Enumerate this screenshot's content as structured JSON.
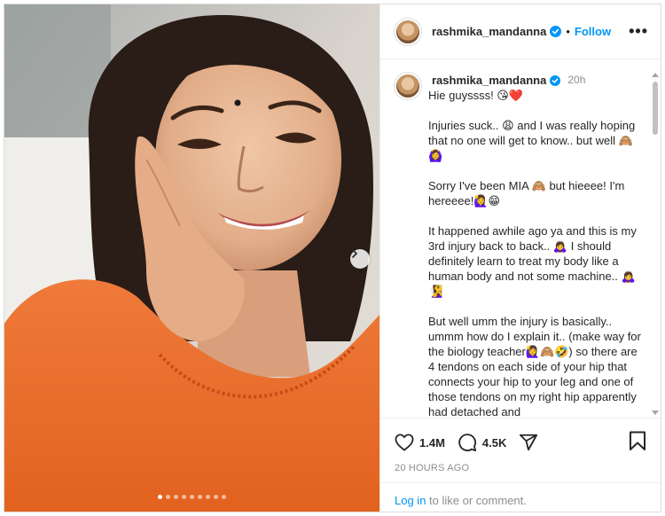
{
  "post": {
    "username": "rashmika_mandanna",
    "follow_label": "Follow",
    "separator": "•",
    "more_label": "•••",
    "time_ago": "20h",
    "caption_first_line": "Hie guyssss! 😘❤️",
    "caption_paragraphs": [
      "Injuries suck.. 😩 and I was really hoping that no one will get to know.. but well 🙈🙆‍♀️",
      "Sorry I've been MIA 🙈 but hieeee! I'm hereeee!🙋‍♀️😁",
      "It happened awhile ago ya and this is my 3rd injury back to back.. 🙇‍♀️ I should definitely learn to treat my body like a human body and not some machine.. 🙇‍♀️🧏‍♀️",
      "But well umm the injury is basically.. ummm how do I explain it.. (make way for the biology teacher🙋‍♀️🙈🤣) so there are 4 tendons on each side of your hip that connects your hip to your leg and one of those tendons on my right hip apparently had detached and"
    ],
    "likes": "1.4M",
    "comments": "4.5K",
    "posted_ago": "20 HOURS AGO",
    "login_link": "Log in",
    "login_rest": " to like or comment.",
    "carousel_total": 9,
    "carousel_active_index": 0
  },
  "colors": {
    "accent": "#0095f6",
    "verified": "#0095f6",
    "muted": "#8e8e8e",
    "text": "#262626"
  },
  "icons": {
    "like": "heart-icon",
    "comment": "comment-bubble-icon",
    "share": "paper-plane-icon",
    "save": "bookmark-icon",
    "next": "chevron-right-icon",
    "verified": "verified-badge-icon"
  }
}
